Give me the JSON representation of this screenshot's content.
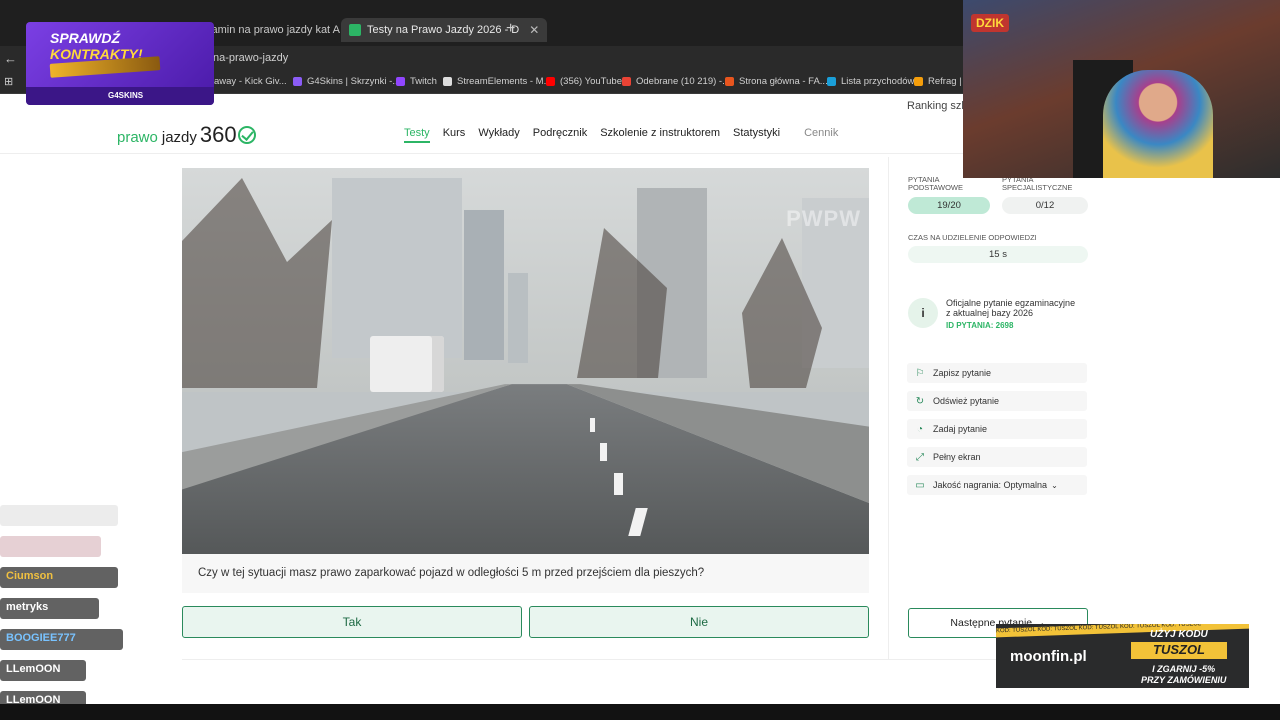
{
  "browser": {
    "tabs": [
      {
        "label": "zamin na prawo jazdy kat A",
        "active": false
      },
      {
        "label": "Testy na Prawo Jazdy 2026 - D",
        "active": true
      }
    ],
    "new_tab": "+",
    "address": "na-prawo-jazdy",
    "bookmarks": [
      "away - Kick Giv...",
      "G4Skins | Skrzynki -...",
      "Twitch",
      "StreamElements - M...",
      "(356) YouTube",
      "Odebrane (10 219) -...",
      "Strona główna - FA...",
      "Lista przychodów",
      "Refrag | D"
    ]
  },
  "site": {
    "ranking": "Ranking szk",
    "logo": {
      "part1": "prawo",
      "part2": "jazdy",
      "part3": "360"
    },
    "nav": [
      "Testy",
      "Kurs",
      "Wykłady",
      "Podręcznik",
      "Szkolenie z instruktorem",
      "Statystyki"
    ],
    "nav_muted": "Cennik"
  },
  "video": {
    "watermark": "PWPW"
  },
  "question": {
    "text": "Czy w tej sytuacji masz prawo zaparkować pojazd w odległości 5 m przed przejściem dla pieszych?",
    "answers": [
      "Tak",
      "Nie"
    ]
  },
  "panel": {
    "basic_label_1": "PYTANIA",
    "basic_label_2": "PODSTAWOWE",
    "spec_label_1": "PYTANIA",
    "spec_label_2": "SPECJALISTYCZNE",
    "basic_value": "19/20",
    "spec_value": "0/12",
    "time_label": "CZAS NA UDZIELENIE ODPOWIEDZI",
    "time_value": "15 s",
    "info_line1": "Oficjalne pytanie egzaminacyjne",
    "info_line2": "z aktualnej bazy 2026",
    "info_id": "ID PYTANIA: 2698",
    "actions": [
      "Zapisz pytanie",
      "Odśwież pytanie",
      "Zadaj pytanie",
      "Pełny ekran",
      "Jakość nagrania: Optymalna"
    ],
    "next_button": "Następne pytanie →"
  },
  "overlays": {
    "promo_title_1": "SPRAWDŹ",
    "promo_title_2": "KONTRAKTY!",
    "promo_brand": "G4SKINS",
    "webcam_badge": "DZIK",
    "chat": [
      "Ciumson",
      "metryks",
      "BOOGIEE777",
      "LLemOON",
      "LLemOON"
    ],
    "ad_brand": "moonfin.pl",
    "ad_line1": "UŻYJ KODU",
    "ad_code": "TUSZOL",
    "ad_line2": "I ZGARNIJ -5%",
    "ad_line3": "PRZY ZAMÓWIENIU",
    "ad_stripe": "KOD: TUSZOL KOD: TUSZOL KOD: TUSZOL KOD: TUSZOL KOD: TUSZOL"
  }
}
